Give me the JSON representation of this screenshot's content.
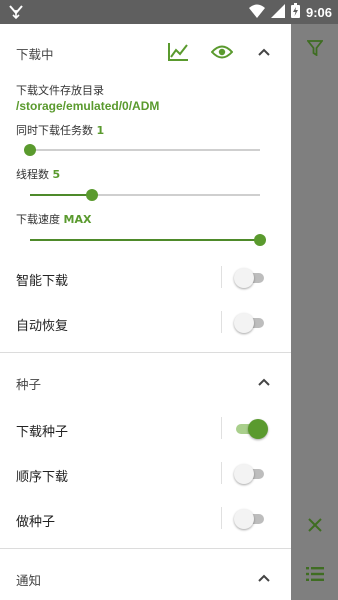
{
  "status_bar": {
    "time": "9:06",
    "left_icon": "download-status-icon",
    "icons": [
      "wifi-icon",
      "signal-icon",
      "battery-icon"
    ]
  },
  "downloading": {
    "title": "下载中",
    "header_icons": [
      "chart-icon",
      "eye-icon",
      "chevron-up-icon"
    ],
    "folder_label": "下载文件存放目录",
    "folder_path": "/storage/emulated/0/ADM",
    "tasks_label": "同时下载任务数",
    "tasks_value": "1",
    "tasks_level": 0.0,
    "threads_label": "线程数",
    "threads_value": "5",
    "threads_level": 0.27,
    "speed_label": "下载速度",
    "speed_value": "MAX",
    "speed_level": 1.0,
    "smart_download": {
      "label": "智能下载",
      "on": false
    },
    "auto_resume": {
      "label": "自动恢复",
      "on": false
    }
  },
  "torrent": {
    "title": "种子",
    "download_torrent": {
      "label": "下载种子",
      "on": true
    },
    "sequential": {
      "label": "顺序下载",
      "on": false
    },
    "seeding": {
      "label": "做种子",
      "on": false
    }
  },
  "notification": {
    "title": "通知"
  },
  "right_bar": {
    "icons": [
      "filter-icon",
      "close-icon",
      "list-icon"
    ]
  },
  "colors": {
    "accent": "#5a9a2e",
    "panel": "#ffffff",
    "side": "#7f7f7f",
    "status_bar": "#5f5f5f"
  }
}
